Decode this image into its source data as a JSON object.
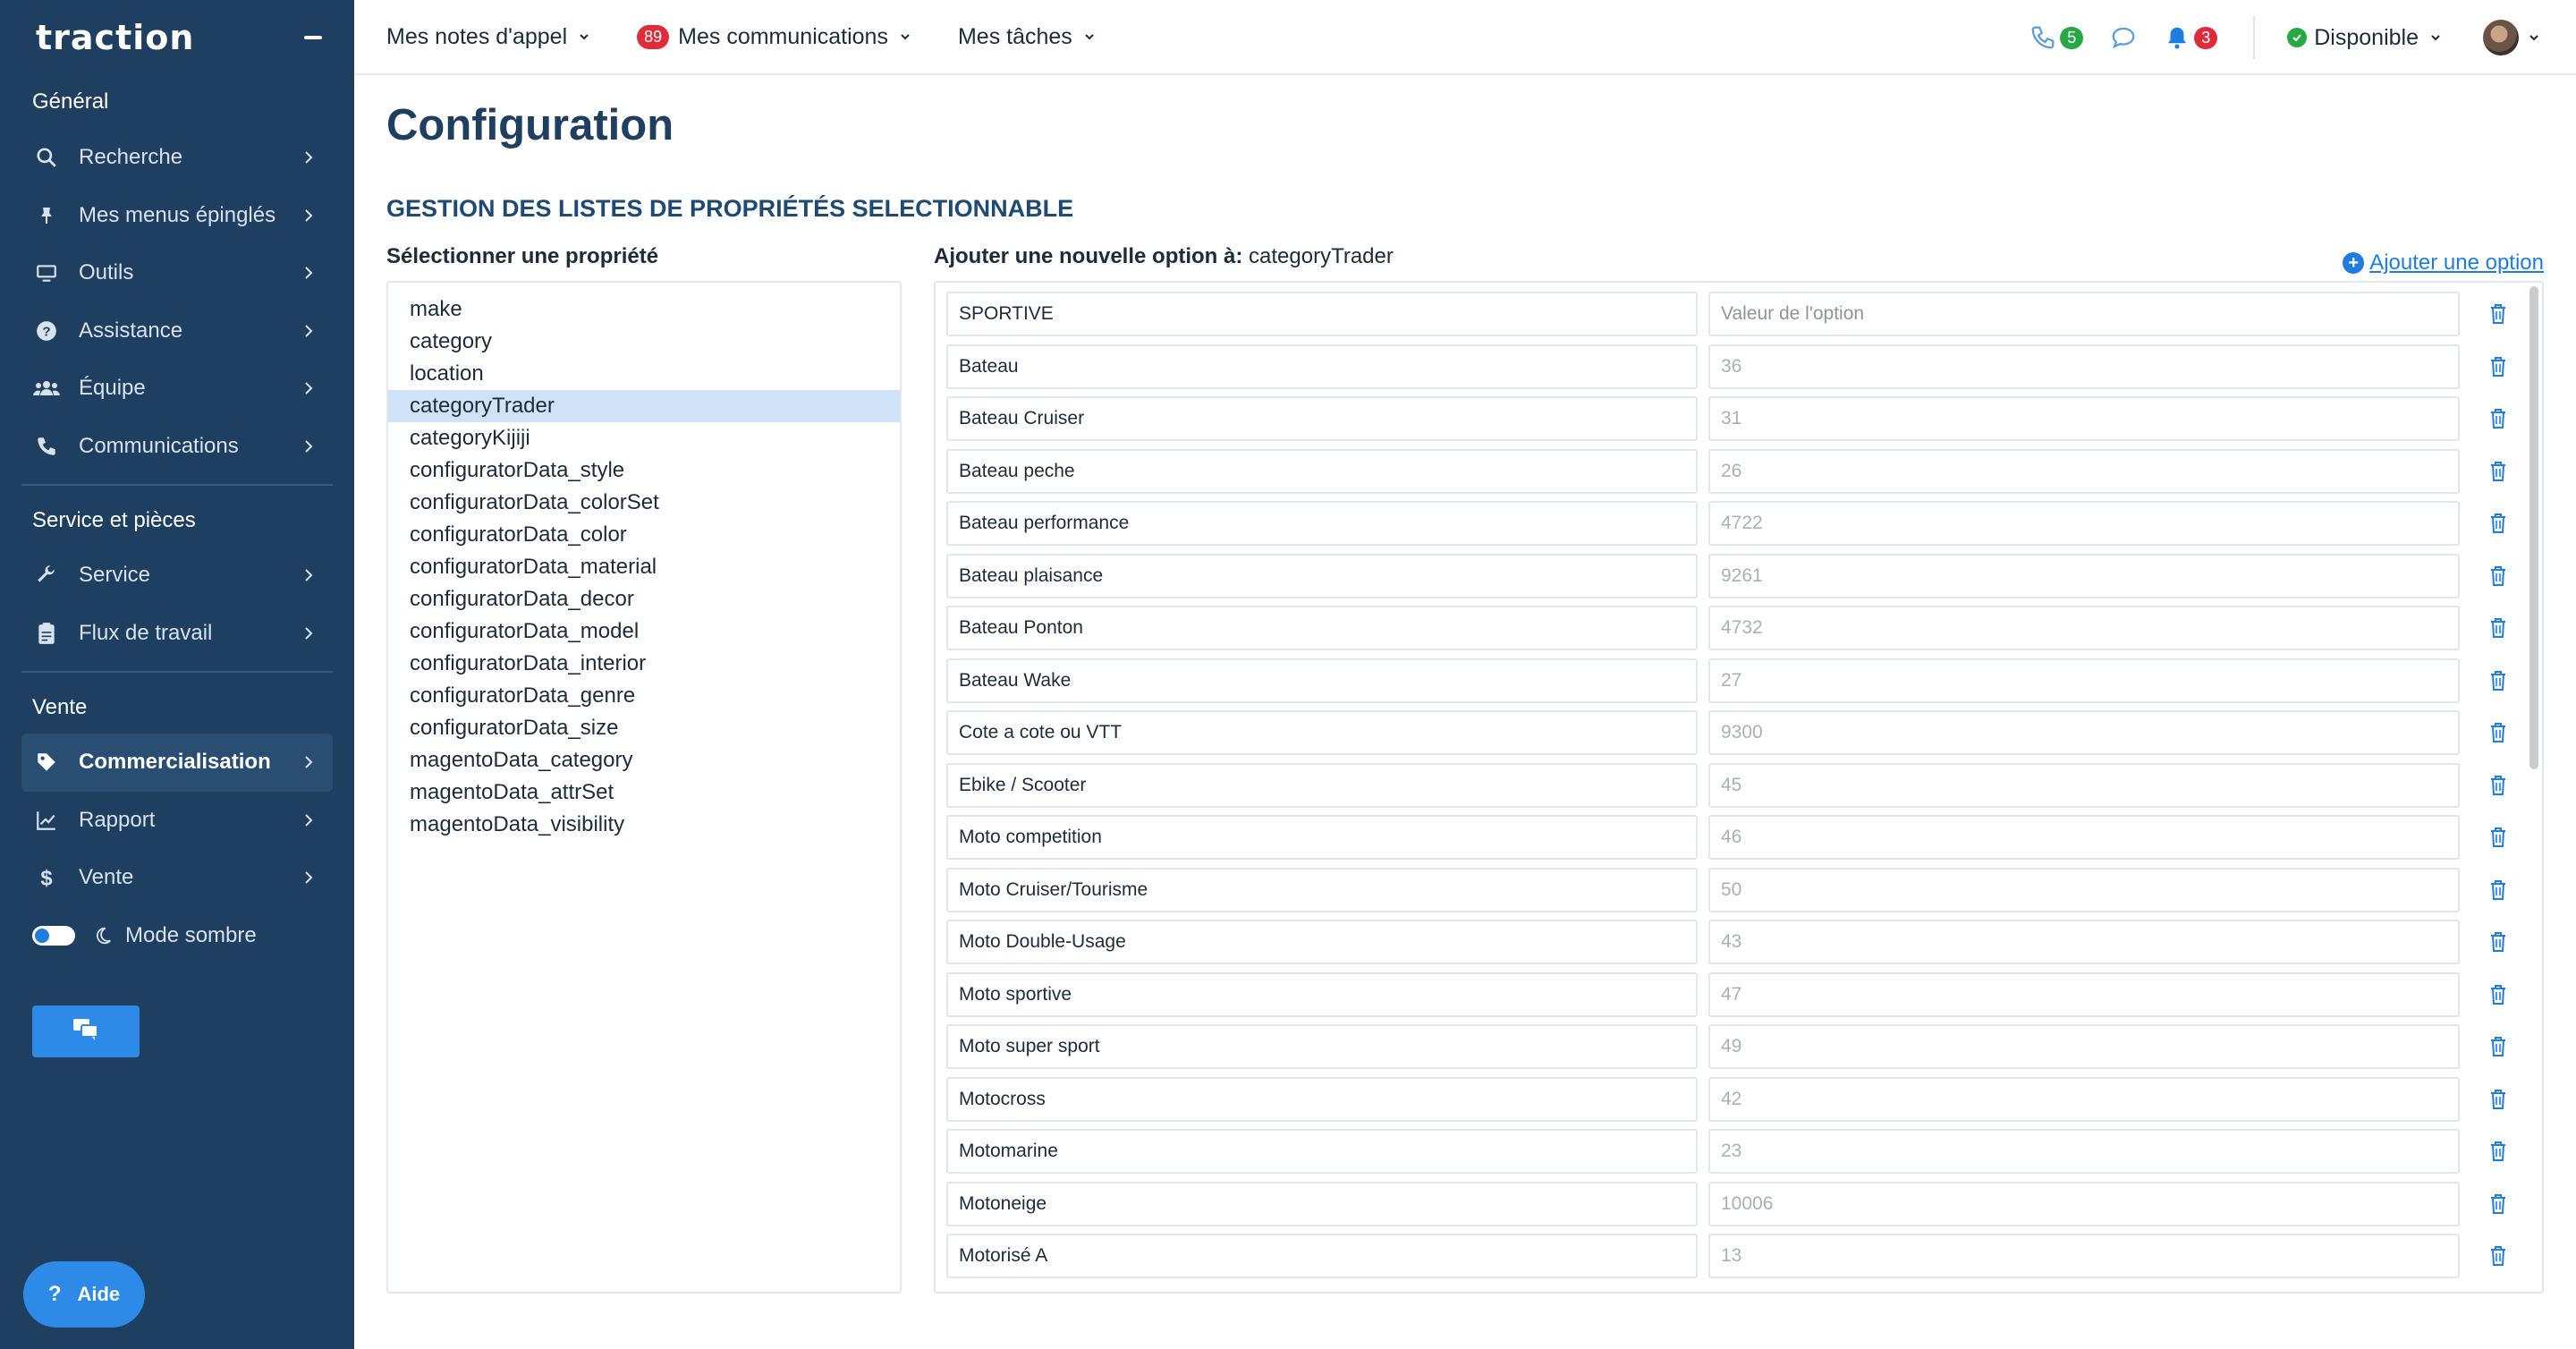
{
  "app": {
    "logo": "traction"
  },
  "sidebar": {
    "sections": [
      {
        "title": "Général",
        "items": [
          {
            "label": "Recherche",
            "icon": "search-icon"
          },
          {
            "label": "Mes menus épinglés",
            "icon": "pin-icon"
          },
          {
            "label": "Outils",
            "icon": "monitor-icon"
          },
          {
            "label": "Assistance",
            "icon": "question-circle-icon"
          },
          {
            "label": "Équipe",
            "icon": "users-icon"
          },
          {
            "label": "Communications",
            "icon": "phone-icon"
          }
        ]
      },
      {
        "title": "Service et pièces",
        "items": [
          {
            "label": "Service",
            "icon": "wrench-icon"
          },
          {
            "label": "Flux de travail",
            "icon": "clipboard-icon"
          }
        ]
      },
      {
        "title": "Vente",
        "items": [
          {
            "label": "Commercialisation",
            "icon": "tag-icon",
            "active": true
          },
          {
            "label": "Rapport",
            "icon": "chart-line-icon"
          },
          {
            "label": "Vente",
            "icon": "dollar-icon"
          }
        ]
      }
    ],
    "dark_mode_label": "Mode sombre",
    "help_label": "Aide"
  },
  "topbar": {
    "menus": [
      {
        "label": "Mes notes d'appel"
      },
      {
        "label": "Mes communications",
        "badge": "89"
      },
      {
        "label": "Mes tâches"
      }
    ],
    "phone_count": "5",
    "notif_count": "3",
    "status_label": "Disponible"
  },
  "page": {
    "title": "Configuration",
    "subtitle": "GESTION DES LISTES DE PROPRIÉTÉS SELECTIONNABLE",
    "select_property_label": "Sélectionner une propriété",
    "add_option_prefix": "Ajouter une nouvelle option à:",
    "add_option_target": "categoryTrader",
    "add_option_link": "Ajouter une option",
    "value_placeholder": "Valeur de l'option"
  },
  "properties": [
    "make",
    "category",
    "location",
    "categoryTrader",
    "categoryKijiji",
    "configuratorData_style",
    "configuratorData_colorSet",
    "configuratorData_color",
    "configuratorData_material",
    "configuratorData_decor",
    "configuratorData_model",
    "configuratorData_interior",
    "configuratorData_genre",
    "configuratorData_size",
    "magentoData_category",
    "magentoData_attrSet",
    "magentoData_visibility"
  ],
  "selected_property": "categoryTrader",
  "options": [
    {
      "name": "SPORTIVE",
      "value": ""
    },
    {
      "name": "Bateau",
      "value": "36"
    },
    {
      "name": "Bateau Cruiser",
      "value": "31"
    },
    {
      "name": "Bateau peche",
      "value": "26"
    },
    {
      "name": "Bateau performance",
      "value": "4722"
    },
    {
      "name": "Bateau plaisance",
      "value": "9261"
    },
    {
      "name": "Bateau Ponton",
      "value": "4732"
    },
    {
      "name": "Bateau Wake",
      "value": "27"
    },
    {
      "name": "Cote a cote ou VTT",
      "value": "9300"
    },
    {
      "name": "Ebike / Scooter",
      "value": "45"
    },
    {
      "name": "Moto competition",
      "value": "46"
    },
    {
      "name": "Moto Cruiser/Tourisme",
      "value": "50"
    },
    {
      "name": "Moto Double-Usage",
      "value": "43"
    },
    {
      "name": "Moto sportive",
      "value": "47"
    },
    {
      "name": "Moto super sport",
      "value": "49"
    },
    {
      "name": "Motocross",
      "value": "42"
    },
    {
      "name": "Motomarine",
      "value": "23"
    },
    {
      "name": "Motoneige",
      "value": "10006"
    },
    {
      "name": "Motorisé A",
      "value": "13"
    }
  ],
  "colors": {
    "sidebar_bg": "#1e3f5f",
    "accent": "#1f7de0",
    "badge_red": "#e02c3a",
    "badge_green": "#28a745"
  }
}
